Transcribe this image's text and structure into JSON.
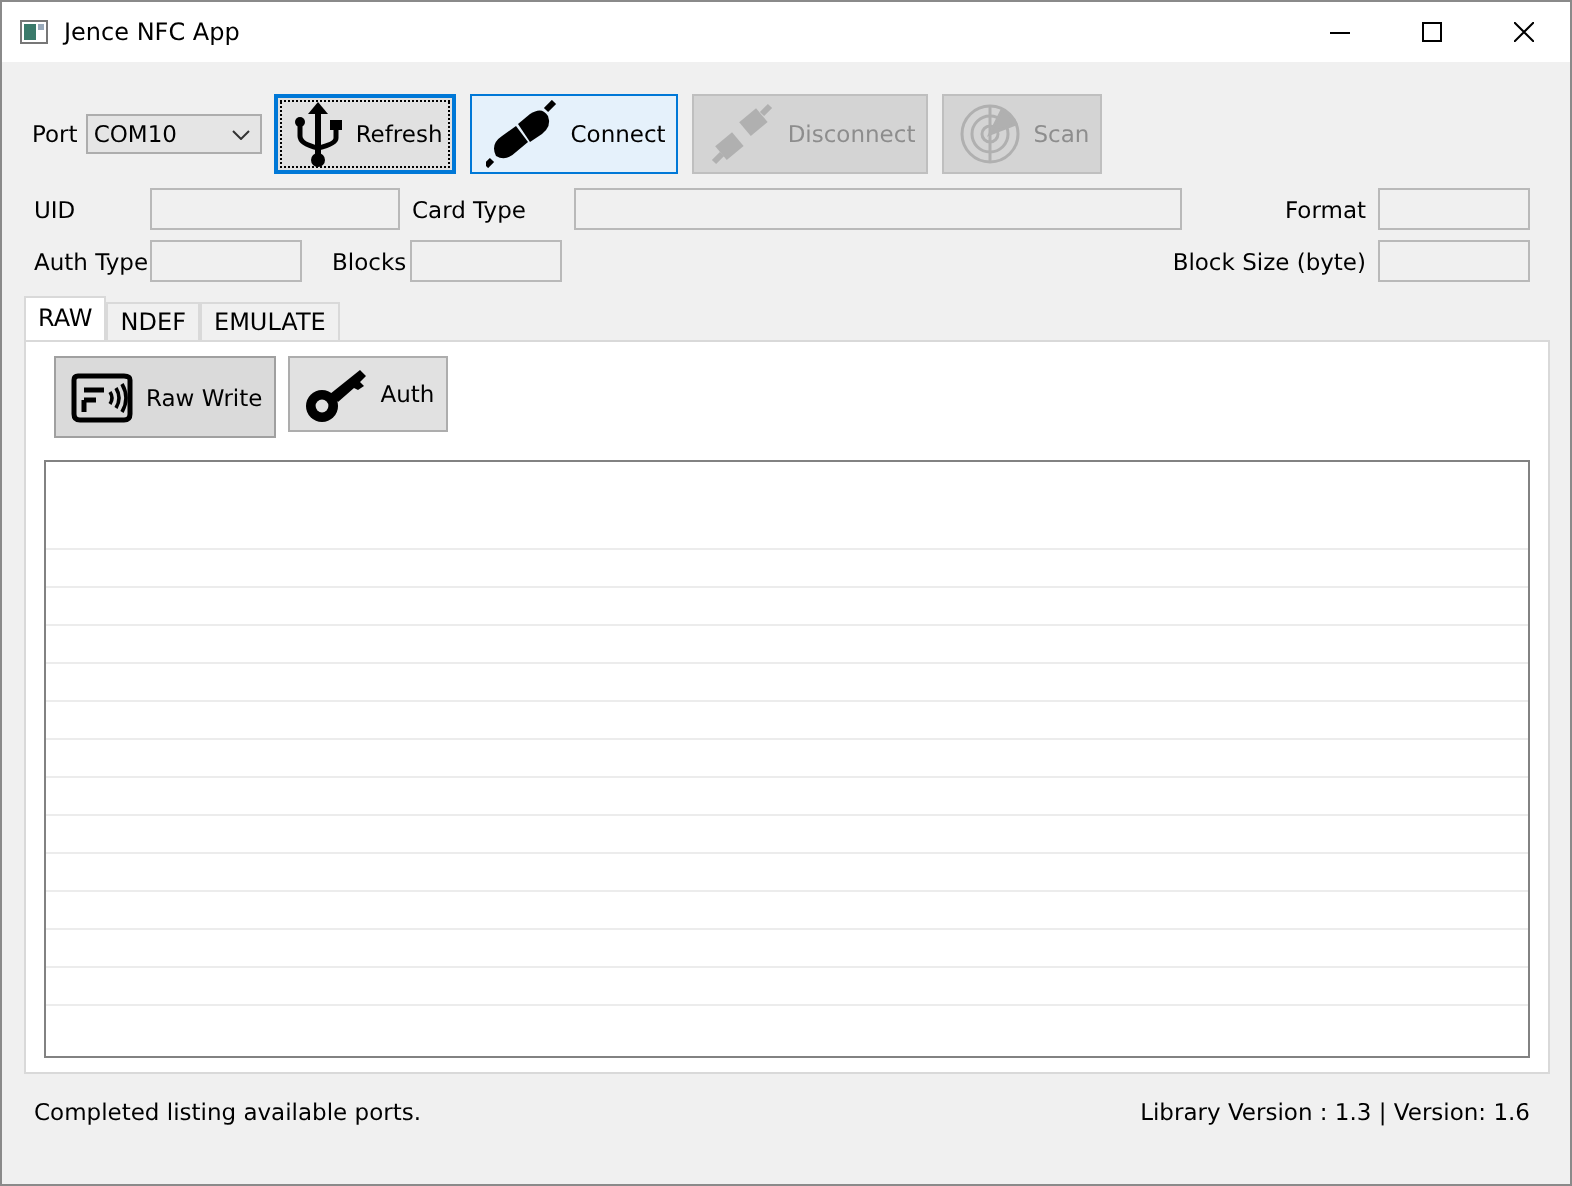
{
  "window": {
    "title": "Jence NFC App"
  },
  "port": {
    "label": "Port",
    "value": "COM10"
  },
  "toolbar": [
    {
      "kind": "usb",
      "label": "Refresh",
      "disabled": false,
      "focused": true,
      "highlighted": false
    },
    {
      "kind": "plug",
      "label": "Connect",
      "disabled": false,
      "focused": false,
      "highlighted": true
    },
    {
      "kind": "unplug",
      "label": "Disconnect",
      "disabled": true,
      "focused": false,
      "highlighted": false
    },
    {
      "kind": "radar",
      "label": "Scan",
      "disabled": true,
      "focused": false,
      "highlighted": false
    }
  ],
  "fields": [
    {
      "label": "UID"
    },
    {
      "label": "Card Type"
    },
    {
      "label": "Format"
    },
    {
      "label": "Auth Type"
    },
    {
      "label": "Blocks"
    },
    {
      "label": "Block Size (byte)"
    }
  ],
  "tabs": [
    {
      "label": "RAW",
      "selected": true
    },
    {
      "label": "NDEF",
      "selected": false
    },
    {
      "label": "EMULATE",
      "selected": false
    }
  ],
  "tab_buttons": [
    {
      "kind": "card",
      "label": "Raw Write",
      "pressed": true
    },
    {
      "kind": "key",
      "label": "Auth",
      "pressed": false
    }
  ],
  "status_bar": {
    "message": "Completed listing available ports.",
    "version": "Library Version : 1.3 | Version: 1.6"
  }
}
